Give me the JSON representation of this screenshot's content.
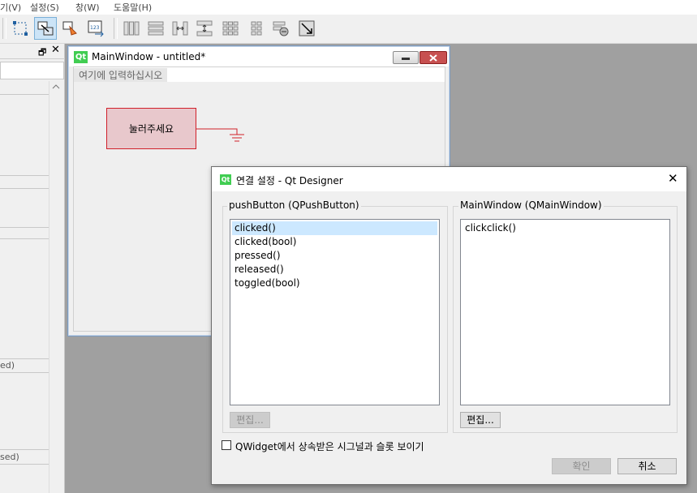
{
  "menubar": {
    "items": [
      "기(V)",
      "설정(S)",
      "창(W)",
      "도움말(H)"
    ]
  },
  "toolbar": {
    "buttons": [
      "edit-widgets-icon",
      "edit-signals-slots-icon",
      "edit-buddies-icon",
      "edit-tab-order-icon",
      "layout-horizontal-icon",
      "layout-vertical-icon",
      "layout-horizontal-splitter-icon",
      "layout-vertical-splitter-icon",
      "layout-grid-icon",
      "layout-form-icon",
      "break-layout-icon",
      "adjust-size-icon"
    ]
  },
  "left_dock": {
    "fragments": [
      "ed)",
      "sed)"
    ]
  },
  "form_window": {
    "logo": "Qt",
    "title": "MainWindow - untitled*",
    "menu_placeholder": "여기에 입력하십시오",
    "push_button_label": "눌러주세요"
  },
  "dialog": {
    "logo": "Qt",
    "title": "연결 설정 - Qt Designer",
    "close_glyph": "✕",
    "sender_group": {
      "title": "pushButton (QPushButton)",
      "signals": [
        "clicked()",
        "clicked(bool)",
        "pressed()",
        "released()",
        "toggled(bool)"
      ],
      "selected_index": 0,
      "edit_label": "편집..."
    },
    "receiver_group": {
      "title": "MainWindow (QMainWindow)",
      "slots": [
        "clickclick()"
      ],
      "edit_label": "편집..."
    },
    "checkbox_label": "QWidget에서 상속받은 시그널과 슬롯 보이기",
    "checkbox_checked": false,
    "ok_label": "확인",
    "cancel_label": "취소"
  },
  "colors": {
    "button_fill": "#e8c8cc",
    "button_border": "#d0202a",
    "selection": "#cce8ff",
    "qt_green": "#41cd52",
    "close_red": "#c75050"
  }
}
